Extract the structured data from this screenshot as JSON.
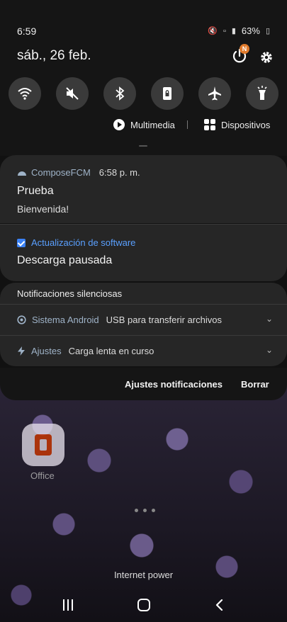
{
  "status_bar": {
    "time": "6:59",
    "battery": "63%"
  },
  "header": {
    "date": "sáb., 26 feb.",
    "badge": "N"
  },
  "quick_toggles": [
    {
      "name": "wifi-icon"
    },
    {
      "name": "sound-muted-icon"
    },
    {
      "name": "bluetooth-icon"
    },
    {
      "name": "rotation-lock-icon"
    },
    {
      "name": "airplane-icon"
    },
    {
      "name": "flashlight-icon"
    }
  ],
  "media_row": {
    "media_label": "Multimedia",
    "devices_label": "Dispositivos"
  },
  "notifications": {
    "compose": {
      "app": "ComposeFCM",
      "time": "6:58 p. m.",
      "title": "Prueba",
      "body": "Bienvenida!"
    },
    "software": {
      "app": "Actualización de software",
      "title": "Descarga pausada"
    },
    "silent": {
      "header": "Notificaciones silenciosas",
      "rows": [
        {
          "source": "Sistema Android",
          "message": "USB para transferir archivos"
        },
        {
          "source": "Ajustes",
          "message": "Carga lenta en curso"
        }
      ]
    },
    "actions": {
      "settings": "Ajustes notificaciones",
      "clear": "Borrar"
    }
  },
  "home": {
    "office_label": "Office",
    "widget_label": "Internet power"
  },
  "colors": {
    "accent_blue": "#5aa0ff",
    "badge_orange": "#e07a2b"
  }
}
